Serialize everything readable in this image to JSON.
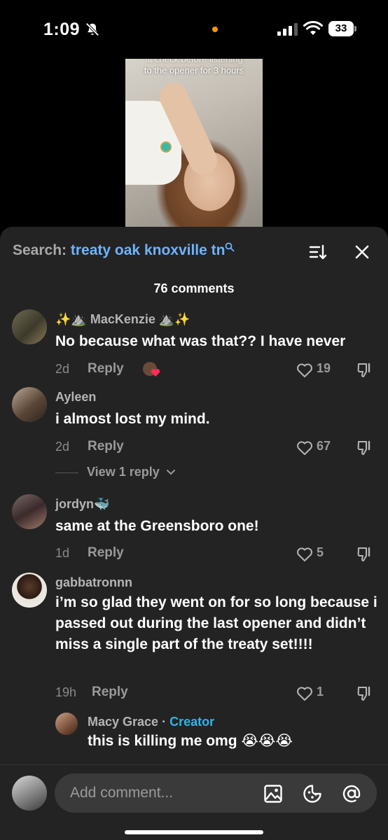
{
  "status": {
    "time": "1:09",
    "battery": "33"
  },
  "video": {
    "caption_line1": "fit check before listening",
    "caption_line2": "to the opener for 3 hours"
  },
  "header": {
    "search_label": "Search:",
    "search_term": "treaty oak knoxville tn",
    "comments_count": "76 comments"
  },
  "comments": [
    {
      "username": "✨⛰️ MacKenzie ⛰️✨",
      "text": "No because what was that?? I have never",
      "age": "2d",
      "reply_label": "Reply",
      "likes": "19"
    },
    {
      "username": "Ayleen",
      "text": "i almost lost my mind.",
      "age": "2d",
      "reply_label": "Reply",
      "likes": "67",
      "view_replies": "View 1 reply"
    },
    {
      "username": "jordyn🐳",
      "text": "same at the Greensboro one!",
      "age": "1d",
      "reply_label": "Reply",
      "likes": "5"
    },
    {
      "username": "gabbatronnn",
      "text": "i’m so glad they went on for so long because i passed out during the last opener and didn’t miss a single part of the treaty set!!!!",
      "age": "19h",
      "reply_label": "Reply",
      "likes": "1"
    }
  ],
  "reply": {
    "username": "Macy Grace",
    "separator": " · ",
    "badge": "Creator",
    "text": "this is killing me omg 😭😭😭"
  },
  "composer": {
    "placeholder": "Add comment..."
  },
  "colors": {
    "panel_bg": "#232323",
    "search_term": "#6fb3ff",
    "creator_badge": "#2fb5e6",
    "status_dot": "#ff9500"
  },
  "icons": [
    "bell-slash-icon",
    "signal-icon",
    "wifi-icon",
    "search-icon",
    "sort-icon",
    "close-icon",
    "heart-icon",
    "dislike-icon",
    "image-icon",
    "sticker-icon",
    "mention-icon"
  ]
}
